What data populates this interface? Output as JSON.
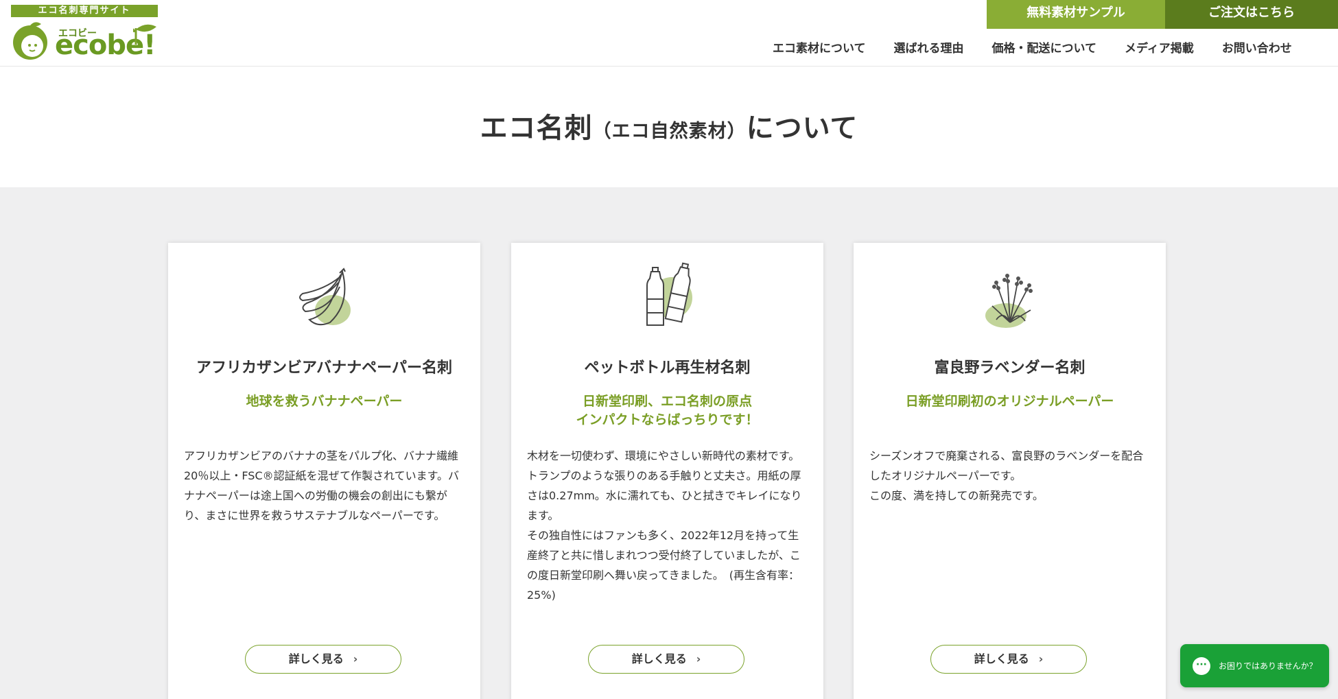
{
  "header": {
    "logo_tagline": "エコ名刺専門サイト",
    "logo_kana": "エコビー",
    "logo_word": "ecobe!",
    "sample_button": "無料素材サンプル",
    "order_button": "ご注文はこちら",
    "nav": [
      "エコ素材について",
      "選ばれる理由",
      "価格・配送について",
      "メディア掲載",
      "お問い合わせ"
    ]
  },
  "page": {
    "title_main": "エコ名刺",
    "title_small": "（エコ自然素材）",
    "title_tail": "について"
  },
  "cards": [
    {
      "icon": "banana-icon",
      "title": "アフリカザンビアバナナペーパー名刺",
      "catch": [
        "地球を救うバナナペーパー"
      ],
      "desc": "アフリカザンビアのバナナの茎をパルプ化、バナナ繊維20％以上・FSC®認証紙を混ぜて作製されています。バナナペーパーは途上国への労働の機会の創出にも繋がり、まさに世界を救うサステナブルなペーパーです。",
      "more": "詳しく見る"
    },
    {
      "icon": "pet-bottle-icon",
      "title": "ペットボトル再生材名刺",
      "catch": [
        "日新堂印刷、エコ名刺の原点",
        "インパクトならばっちりです！"
      ],
      "desc": "木材を一切使わず、環境にやさしい新時代の素材です。\nトランプのような張りのある手触りと丈夫さ。用紙の厚さは0.27mm。水に濡れても、ひと拭きでキレイになります。\nその独自性にはファンも多く、2022年12月を持って生産終了と共に惜しまれつつ受付終了していましたが、この度日新堂印刷へ舞い戻ってきました。　(再生含有率：25%)",
      "more": "詳しく見る"
    },
    {
      "icon": "lavender-icon",
      "title": "富良野ラベンダー名刺",
      "catch": [
        "日新堂印刷初のオリジナルペーパー"
      ],
      "desc": "シーズンオフで廃棄される、富良野のラベンダーを配合したオリジナルペーパーです。\nこの度、満を持しての新発売です。",
      "more": "詳しく見る"
    }
  ],
  "help_chat": "お困りではありませんか？",
  "colors": {
    "accent": "#7aa22a",
    "accent_dark": "#5b7c1d",
    "chat": "#1aa137"
  }
}
